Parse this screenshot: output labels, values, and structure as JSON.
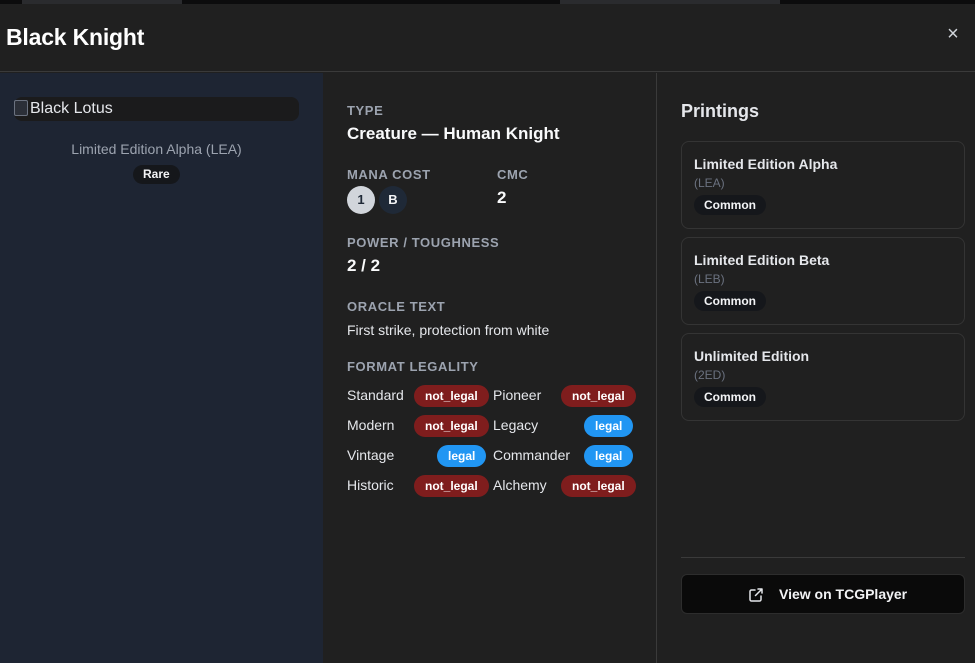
{
  "modal": {
    "title": "Black Knight",
    "close_icon": "close-icon"
  },
  "card": {
    "image_alt": "Black Lotus",
    "set_name": "Limited Edition Alpha (LEA)",
    "rarity": "Rare"
  },
  "details": {
    "type_label": "TYPE",
    "type_value": "Creature — Human Knight",
    "mana_cost_label": "MANA COST",
    "mana_symbols": [
      "1",
      "B"
    ],
    "cmc_label": "CMC",
    "cmc_value": "2",
    "pt_label": "POWER / TOUGHNESS",
    "pt_value": "2 / 2",
    "oracle_label": "ORACLE TEXT",
    "oracle_text": "First strike, protection from white",
    "legality_label": "FORMAT LEGALITY",
    "legalities": [
      {
        "format": "Standard",
        "status": "not_legal"
      },
      {
        "format": "Pioneer",
        "status": "not_legal"
      },
      {
        "format": "Modern",
        "status": "not_legal"
      },
      {
        "format": "Legacy",
        "status": "legal"
      },
      {
        "format": "Vintage",
        "status": "legal"
      },
      {
        "format": "Commander",
        "status": "legal"
      },
      {
        "format": "Historic",
        "status": "not_legal"
      },
      {
        "format": "Alchemy",
        "status": "not_legal"
      }
    ]
  },
  "printings": {
    "title": "Printings",
    "items": [
      {
        "name": "Limited Edition Alpha",
        "code": "(LEA)",
        "rarity": "Common"
      },
      {
        "name": "Limited Edition Beta",
        "code": "(LEB)",
        "rarity": "Common"
      },
      {
        "name": "Unlimited Edition",
        "code": "(2ED)",
        "rarity": "Common"
      }
    ],
    "tcg_button_label": "View on TCGPlayer",
    "tcg_button_icon": "external-link-icon"
  },
  "colors": {
    "not_legal": "#7f1d1d",
    "legal": "#2196f3",
    "left_panel_bg": "#1e2533"
  }
}
